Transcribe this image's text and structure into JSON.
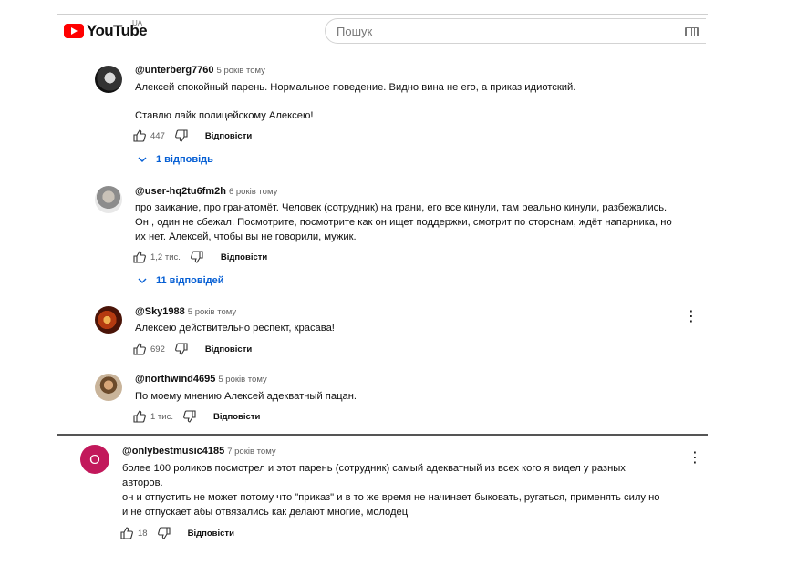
{
  "header": {
    "logo_text": "YouTube",
    "country": "UA",
    "search_placeholder": "Пошук"
  },
  "reply_label": "Відповісти",
  "comments": [
    {
      "author": "@unterberg7760",
      "time": "5 років тому",
      "lines": [
        "Алексей спокойный парень. Нормальное поведение. Видно вина не его, а приказ идиотский.",
        "Ставлю лайк полицейскому Алексею!"
      ],
      "likes": "447",
      "replies": "1 відповідь"
    },
    {
      "author": "@user-hq2tu6fm2h",
      "time": "6 років тому",
      "lines": [
        "про заикание, про гранатомёт. Человек (сотрудник) на грани, его все кинули, там реально кинули, разбежались.",
        "Он , один не сбежал. Посмотрите, посмотрите как он ищет поддержки, смотрит по сторонам, ждёт напарника, но",
        "их нет. Алексей, чтобы вы не говорили, мужик."
      ],
      "likes": "1,2 тис.",
      "replies": "11 відповідей"
    },
    {
      "author": "@Sky1988",
      "time": "5 років тому",
      "lines": [
        "Алексею действительно респект, красава!"
      ],
      "likes": "692"
    },
    {
      "author": "@northwind4695",
      "time": "5 років тому",
      "lines": [
        "По моему мнению Алексей адекватный пацан."
      ],
      "likes": "1 тис."
    },
    {
      "author": "@onlybestmusic4185",
      "time": "7 років тому",
      "avatar_letter": "O",
      "lines": [
        "более 100 роликов посмотрел и этот парень (сотрудник) самый адекватный из всех кого я видел у разных",
        "авторов.",
        "он и отпустить не может потому что \"приказ\" и в то же время не начинает быковать, ругаться, применять силу но",
        "и не отпускает абы отвязались как делают многие, молодец"
      ],
      "likes": "18"
    }
  ],
  "colors": {
    "accent_blue": "#065fd4",
    "youtube_red": "#ff0000",
    "avatar_o": "#c2185b"
  }
}
